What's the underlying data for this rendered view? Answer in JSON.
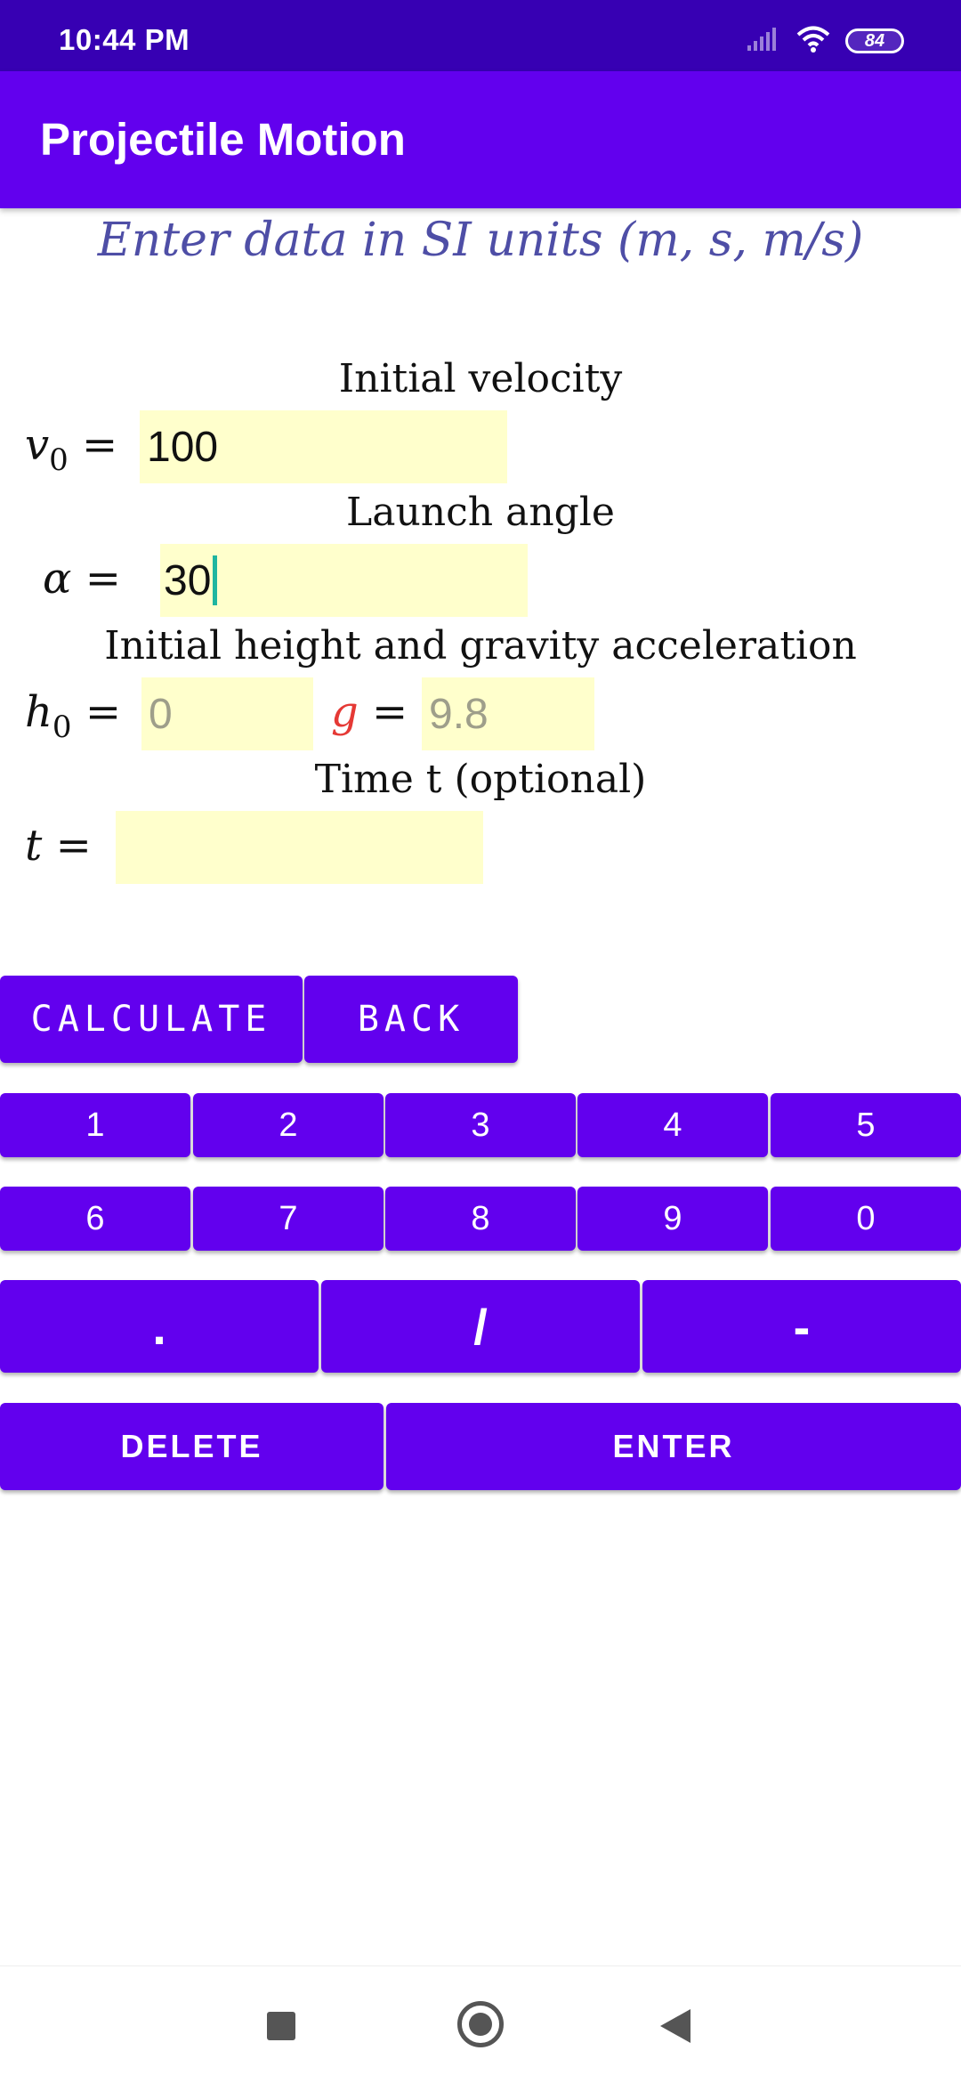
{
  "status_bar": {
    "time": "10:44 PM",
    "battery": "84",
    "icons": [
      "signal-icon",
      "wifi-icon",
      "battery-icon"
    ]
  },
  "app_bar": {
    "title": "Projectile Motion"
  },
  "instructions": "Enter data in SI units (m, s, m/s)",
  "sections": {
    "velocity": "Initial velocity",
    "angle": "Launch angle",
    "height_gravity": "Initial height and gravity acceleration",
    "time": "Time t (optional)"
  },
  "fields": {
    "v0": {
      "symbol": "v",
      "subscript": "0",
      "value": "100"
    },
    "alpha": {
      "symbol": "α",
      "value": "30"
    },
    "h0": {
      "symbol": "h",
      "subscript": "0",
      "placeholder": "0"
    },
    "g": {
      "symbol": "g",
      "placeholder": "9.8"
    },
    "t": {
      "symbol": "t",
      "value": ""
    },
    "equals": "="
  },
  "buttons": {
    "calculate": "CALCULATE",
    "back": "BACK",
    "digits_row1": [
      "1",
      "2",
      "3",
      "4",
      "5"
    ],
    "digits_row2": [
      "6",
      "7",
      "8",
      "9",
      "0"
    ],
    "symbols": [
      ".",
      "/",
      "-"
    ],
    "delete": "DELETE",
    "enter": "ENTER"
  },
  "colors": {
    "status_bar": "#3700b3",
    "primary": "#6200ee",
    "field_background": "#ffffcc",
    "instruction_text": "#4e4ea6",
    "gravity_symbol": "#e53935",
    "cursor": "#1fb5a0"
  }
}
